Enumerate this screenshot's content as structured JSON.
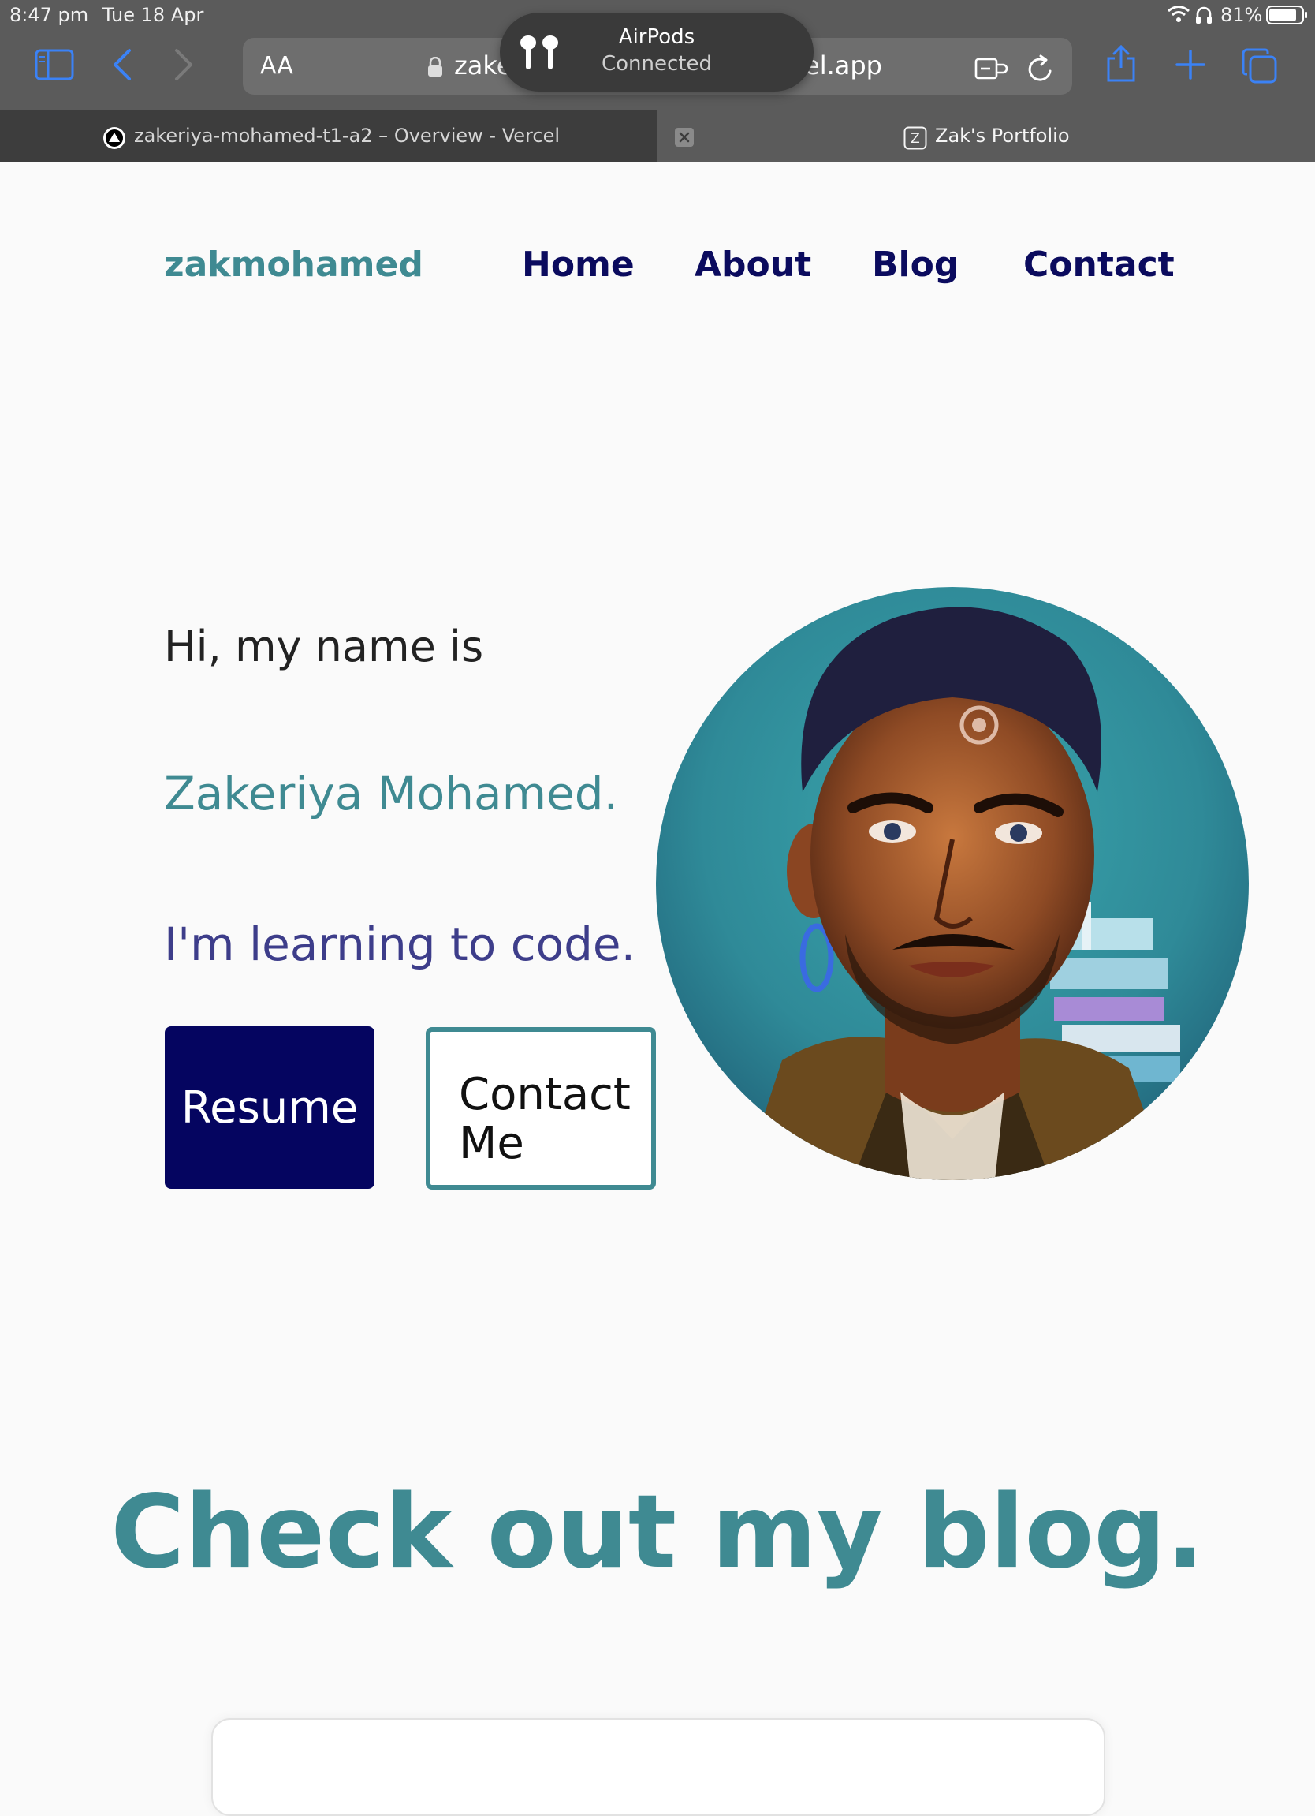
{
  "status_bar": {
    "time": "8:47 pm",
    "date": "Tue 18 Apr",
    "battery": "81%"
  },
  "toolbar": {
    "reader_label": "AA",
    "url_left": "zake",
    "url_right": "el.app"
  },
  "notification": {
    "title": "AirPods",
    "subtitle": "Connected"
  },
  "tabs": [
    {
      "label": "zakeriya-mohamed-t1-a2 – Overview - Vercel",
      "favicon": "Λ"
    },
    {
      "label": "Zak's Portfolio",
      "favicon": "Z"
    }
  ],
  "site": {
    "brand": "zakmohamed",
    "nav": [
      "Home",
      "About",
      "Blog",
      "Contact"
    ]
  },
  "hero": {
    "intro": "Hi, my name is",
    "name": "Zakeriya Mohamed.",
    "tagline": "I'm learning to code.",
    "resume_button": "Resume",
    "contact_button_line1": "Contact",
    "contact_button_line2": "Me"
  },
  "blog": {
    "heading": "Check out my blog."
  },
  "colors": {
    "accent_teal": "#3f8a92",
    "navy": "#050560",
    "nav_text": "#0b0b5e",
    "tagline": "#3d3d8a",
    "chrome": "#5b5b5b"
  }
}
